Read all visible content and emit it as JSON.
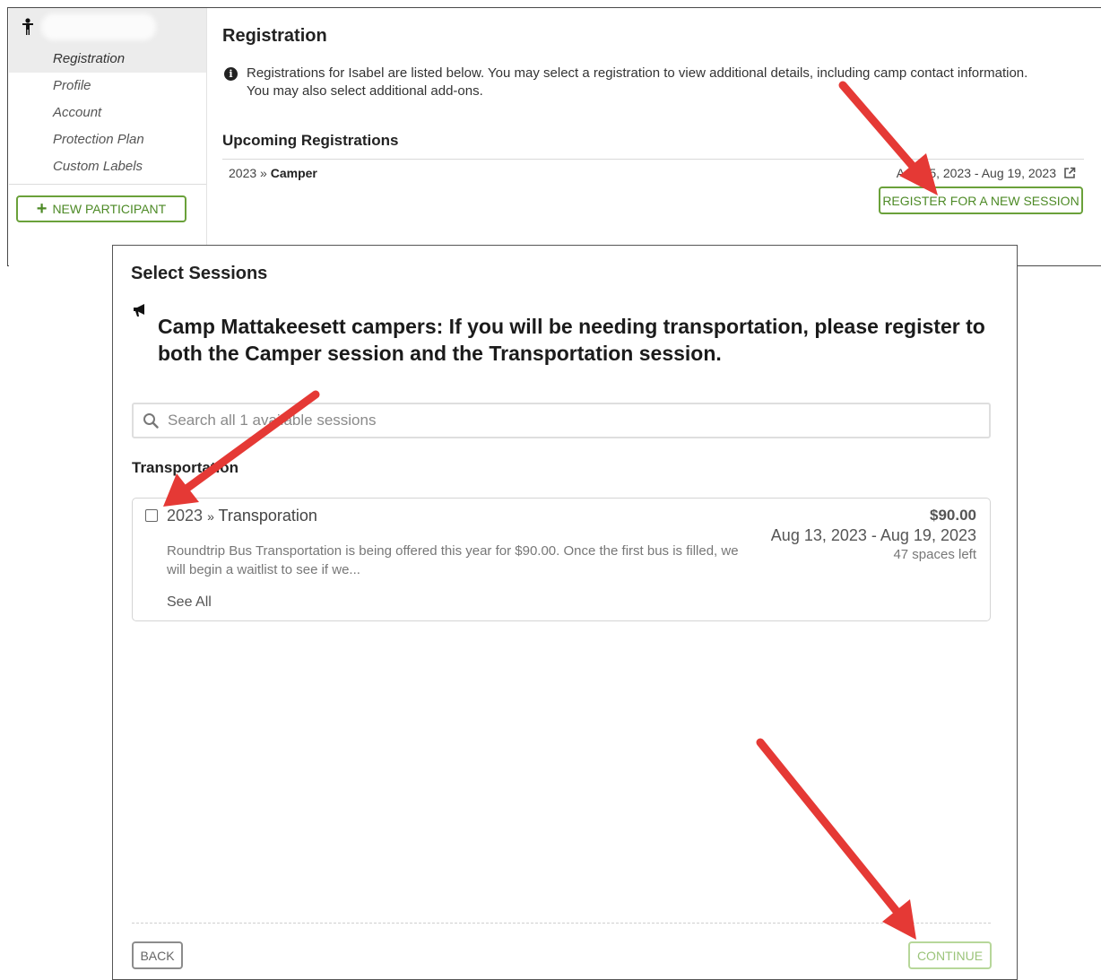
{
  "sidebar": {
    "items": [
      {
        "label": "Registration",
        "active": true
      },
      {
        "label": "Profile",
        "active": false
      },
      {
        "label": "Account",
        "active": false
      },
      {
        "label": "Protection Plan",
        "active": false
      },
      {
        "label": "Custom Labels",
        "active": false
      }
    ],
    "new_participant_label": "NEW PARTICIPANT"
  },
  "main": {
    "title": "Registration",
    "info_text": "Registrations for Isabel are listed below. You may select a registration to view additional details, including camp contact information. You may also select additional add-ons.",
    "upcoming_title": "Upcoming Registrations",
    "registration": {
      "year": "2023",
      "separator": "»",
      "name": "Camper",
      "dates": "Aug 15, 2023 - Aug 19, 2023"
    },
    "register_button_label": "REGISTER FOR A NEW SESSION"
  },
  "modal": {
    "title": "Select Sessions",
    "announcement": "Camp Mattakeesett campers: If you will be needing transportation, please register to both the Camper session and the Transportation session.",
    "search_placeholder": "Search all 1 available sessions",
    "section_label": "Transportation",
    "session": {
      "year": "2023",
      "separator": "»",
      "name": "Transporation",
      "description": "Roundtrip Bus Transportation is being offered this year for $90.00. Once the first bus is filled, we will begin a waitlist to see if we...",
      "see_all": "See All",
      "price": "$90.00",
      "dates": "Aug 13, 2023 - Aug 19, 2023",
      "spaces": "47 spaces left",
      "checked": false
    },
    "back_label": "BACK",
    "continue_label": "CONTINUE"
  },
  "colors": {
    "accent_green": "#6aa13a",
    "arrow_red": "#e53935"
  }
}
